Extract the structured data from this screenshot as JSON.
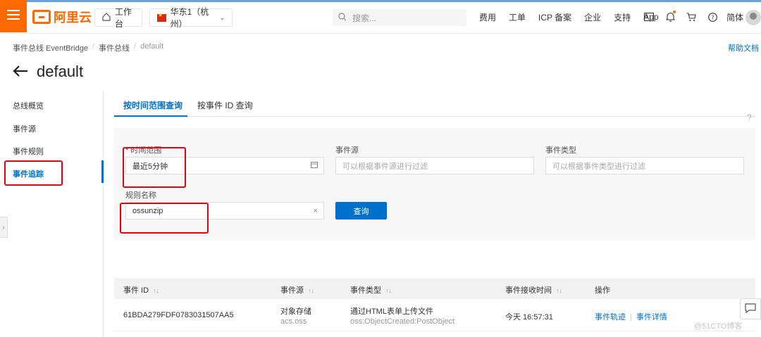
{
  "topbar": {
    "brand": "阿里云",
    "workbench": "工作台",
    "region": "华东1（杭州）",
    "search_placeholder": "搜索...",
    "links": [
      "费用",
      "工单",
      "ICP 备案",
      "企业",
      "支持",
      "App"
    ],
    "language": "简体"
  },
  "breadcrumb": [
    "事件总线 EventBridge",
    "事件总线",
    "default"
  ],
  "help_doc": "帮助文档",
  "page_title": "default",
  "sidenav": {
    "items": [
      "总线概览",
      "事件源",
      "事件规则",
      "事件追踪"
    ],
    "active": "事件追踪"
  },
  "tabs": [
    "按时间范围查询",
    "按事件 ID 查询"
  ],
  "filters": {
    "time_range_label": "* 时间范围",
    "time_range_value": "最近5分钟",
    "event_source_label": "事件源",
    "event_source_placeholder": "可以根据事件源进行过滤",
    "event_type_label": "事件类型",
    "event_type_placeholder": "可以根据事件类型进行过滤",
    "rule_name_label": "规则名称",
    "rule_name_value": "ossunzip",
    "query_button": "查询"
  },
  "table": {
    "headers": [
      "事件 ID",
      "事件源",
      "事件类型",
      "事件接收时间",
      "操作"
    ],
    "rows": [
      {
        "event_id": "61BDA279FDF0783031507AA5",
        "source": "对象存储",
        "source_sub": "acs.oss",
        "type": "通过HTML表单上传文件",
        "type_sub": "oss:ObjectCreated:PostObject",
        "time": "今天 16:57:31",
        "action_trace": "事件轨迹",
        "action_detail": "事件详情"
      }
    ]
  },
  "watermark": "@51CTO博客",
  "colors": {
    "brand": "#ff6a00",
    "primary": "#0070cc",
    "highlight_box": "#e60012"
  }
}
